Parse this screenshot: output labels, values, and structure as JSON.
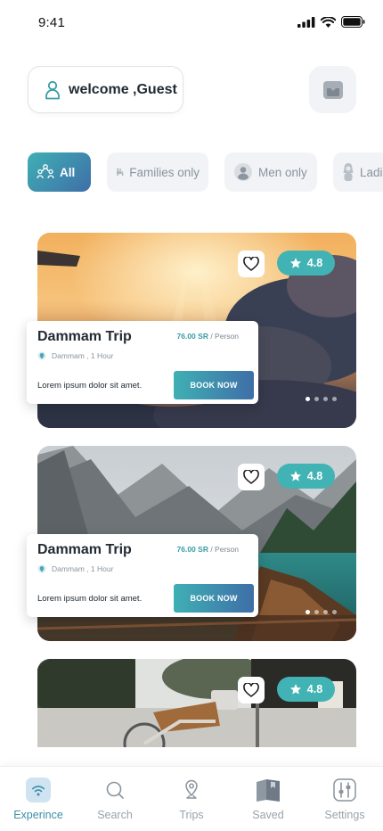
{
  "status_bar": {
    "time": "9:41"
  },
  "header": {
    "welcome_text": "welcome ,Guest",
    "user_icon": "user-icon",
    "action_icon": "inbox-icon"
  },
  "filters": [
    {
      "label": "All",
      "icon": "group-icon",
      "active": true
    },
    {
      "label": "Families only",
      "icon": "family-icon",
      "active": false
    },
    {
      "label": "Men only",
      "icon": "man-icon",
      "active": false
    },
    {
      "label": "Ladie",
      "icon": "woman-icon",
      "active": false
    }
  ],
  "trips": [
    {
      "title": "Dammam Trip",
      "price": "76.00 SR",
      "price_unit": " / Person",
      "location": "Dammam , 1 Hour",
      "description": "Lorem ipsum dolor sit amet.",
      "button": "BOOK NOW",
      "rating": "4.8",
      "image": "sunset-clouds-photo"
    },
    {
      "title": "Dammam Trip",
      "price": "76.00 SR",
      "price_unit": " / Person",
      "location": "Dammam , 1 Hour",
      "description": "Lorem ipsum dolor sit amet.",
      "button": "BOOK NOW",
      "rating": "4.8",
      "image": "mountain-lake-boat-photo"
    },
    {
      "rating": "4.8",
      "image": "street-bicycle-photo"
    }
  ],
  "bottom_nav": [
    {
      "label": "Experince",
      "icon": "wifi-icon",
      "active": true
    },
    {
      "label": "Search",
      "icon": "search-icon",
      "active": false
    },
    {
      "label": "Trips",
      "icon": "map-pin-icon",
      "active": false
    },
    {
      "label": "Saved",
      "icon": "bookmark-icon",
      "active": false
    },
    {
      "label": "Settings",
      "icon": "sliders-icon",
      "active": false
    }
  ],
  "colors": {
    "accent_start": "#3fb0b4",
    "accent_end": "#3f6ea8",
    "rating_bg": "#42b3b4",
    "nav_active": "#3d8fa7"
  }
}
